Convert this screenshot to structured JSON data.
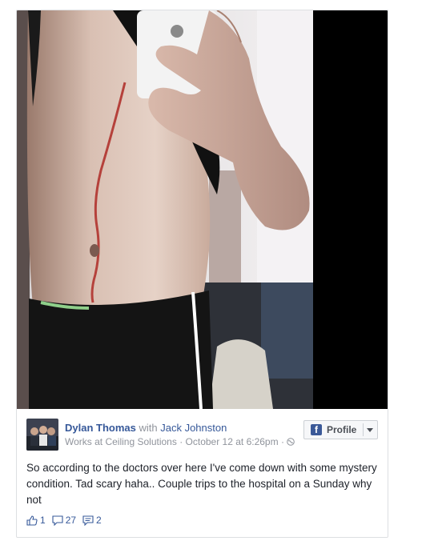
{
  "post": {
    "author": "Dylan Thomas",
    "with_word": "with",
    "tagged": "Jack Johnston",
    "work": "Works at Ceiling Solutions",
    "separator": "·",
    "date": "October 12 at 6:26pm",
    "privacy_icon": "globe-icon",
    "text": "So according to the doctors over here I've come down with some mystery condition. Tad scary haha.. Couple trips to the hospital on a Sunday why not",
    "profile_button": "Profile",
    "likes": "1",
    "comments": "27",
    "shares": "2"
  },
  "colors": {
    "link": "#365899",
    "muted": "#90949c",
    "text": "#1d2129",
    "brand": "#3b5998"
  }
}
